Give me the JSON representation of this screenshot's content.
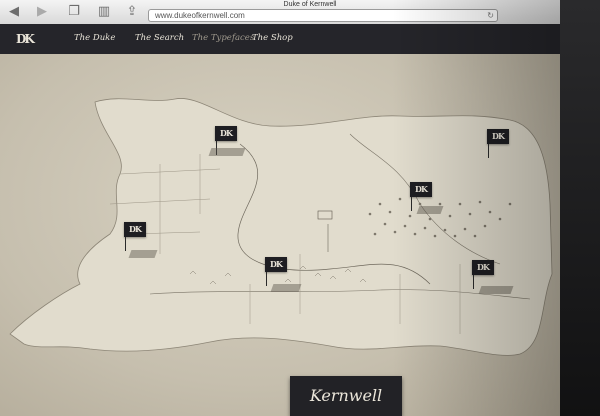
{
  "browser": {
    "page_title": "Duke of Kernwell",
    "url": "www.dukeofkernwell.com",
    "icons": {
      "back": "back-arrow-icon",
      "forward": "forward-arrow-icon",
      "tabs": "tabs-icon",
      "bookmarks": "bookmarks-icon",
      "share": "share-icon",
      "reload": "reload-icon"
    }
  },
  "site": {
    "logo": "DK",
    "nav": [
      {
        "label": "The Duke"
      },
      {
        "label": "The Search"
      },
      {
        "label": "The Typefaces"
      },
      {
        "label": "The Shop"
      }
    ],
    "active_nav": "The Typefaces"
  },
  "map": {
    "markers": [
      {
        "label": "DK"
      },
      {
        "label": "DK"
      },
      {
        "label": "DK"
      },
      {
        "label": "DK"
      },
      {
        "label": "DK"
      },
      {
        "label": "DK"
      }
    ],
    "title": "Kernwell"
  }
}
